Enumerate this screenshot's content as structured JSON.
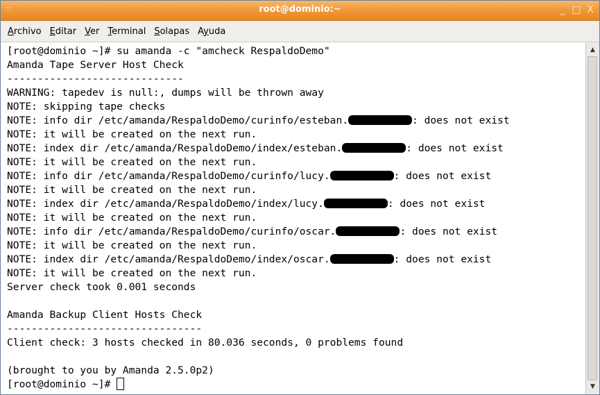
{
  "window": {
    "title": "root@dominio:~",
    "controls": {
      "minimize": "_",
      "maximize": "□",
      "close": "X"
    }
  },
  "menu": {
    "items": [
      {
        "accel": "A",
        "rest": "rchivo"
      },
      {
        "accel": "E",
        "rest": "ditar"
      },
      {
        "accel": "V",
        "rest": "er"
      },
      {
        "accel": "T",
        "rest": "erminal"
      },
      {
        "accel": "S",
        "rest": "olapas"
      },
      {
        "pre": "A",
        "accel": "y",
        "rest": "uda"
      }
    ]
  },
  "terminal": {
    "lines": [
      {
        "text": "[root@dominio ~]# su amanda -c \"amcheck RespaldoDemo\""
      },
      {
        "text": "Amanda Tape Server Host Check"
      },
      {
        "text": "-----------------------------"
      },
      {
        "text": "WARNING: tapedev is null:, dumps will be thrown away"
      },
      {
        "text": "NOTE: skipping tape checks"
      },
      {
        "pre": "NOTE: info dir /etc/amanda/RespaldoDemo/curinfo/esteban.",
        "post": ": does not exist"
      },
      {
        "text": "NOTE: it will be created on the next run."
      },
      {
        "pre": "NOTE: index dir /etc/amanda/RespaldoDemo/index/esteban.",
        "post": ": does not exist"
      },
      {
        "text": "NOTE: it will be created on the next run."
      },
      {
        "pre": "NOTE: info dir /etc/amanda/RespaldoDemo/curinfo/lucy.",
        "post": ": does not exist"
      },
      {
        "text": "NOTE: it will be created on the next run."
      },
      {
        "pre": "NOTE: index dir /etc/amanda/RespaldoDemo/index/lucy.",
        "post": ": does not exist"
      },
      {
        "text": "NOTE: it will be created on the next run."
      },
      {
        "pre": "NOTE: info dir /etc/amanda/RespaldoDemo/curinfo/oscar.",
        "post": ": does not exist"
      },
      {
        "text": "NOTE: it will be created on the next run."
      },
      {
        "pre": "NOTE: index dir /etc/amanda/RespaldoDemo/index/oscar.",
        "post": ": does not exist"
      },
      {
        "text": "NOTE: it will be created on the next run."
      },
      {
        "text": "Server check took 0.001 seconds"
      },
      {
        "text": ""
      },
      {
        "text": "Amanda Backup Client Hosts Check"
      },
      {
        "text": "--------------------------------"
      },
      {
        "text": "Client check: 3 hosts checked in 80.036 seconds, 0 problems found"
      },
      {
        "text": ""
      },
      {
        "text": "(brought to you by Amanda 2.5.0p2)"
      }
    ],
    "prompt": "[root@dominio ~]# "
  }
}
